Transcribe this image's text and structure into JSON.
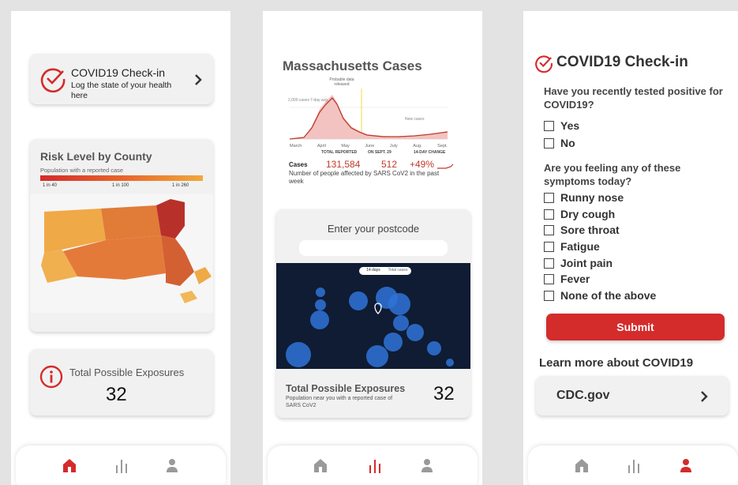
{
  "colors": {
    "accent": "#d42b2b",
    "text": "#222222",
    "grey_icon": "#9a9a9a",
    "map_dark": "#0f1c33",
    "bubble": "#2f73d8"
  },
  "screen1": {
    "checkin": {
      "title": "COVID19 Check-in",
      "subtitle": "Log the state of your health here"
    },
    "risk": {
      "title": "Risk Level by County",
      "legend_caption": "Population with a reported case",
      "legend_ticks": [
        "1 in 40",
        "1 in 100",
        "1 in 260"
      ]
    },
    "exposures": {
      "label": "Total Possible Exposures",
      "value": "32"
    }
  },
  "screen2": {
    "title": "Massachusetts Cases",
    "chart_annotations": {
      "probable": "Probable data released",
      "ytick": "2,000 cases",
      "avg": "7-day avg.",
      "new_cases": "New cases"
    },
    "months": [
      "March",
      "April",
      "May",
      "June",
      "July",
      "Aug.",
      "Sept."
    ],
    "table": {
      "h1": "TOTAL REPORTED",
      "h2": "ON SEPT. 29",
      "h3": "14-DAY CHANGE",
      "row_label": "Cases",
      "total": "131,584",
      "day": "512",
      "change": "+49%"
    },
    "chart_caption": "Number of people affected by SARS CoV2 in the past week",
    "postcode": {
      "label": "Enter your postcode",
      "placeholder": ""
    },
    "map_toggle": [
      "14 days",
      "Total cases"
    ],
    "exposures": {
      "label": "Total Possible Exposures",
      "caption": "Population near you with a reported case of SARS CoV2",
      "value": "32"
    }
  },
  "screen3": {
    "title": "COVID19 Check-in",
    "q1": "Have you recently tested positive for COVID19?",
    "q1_options": [
      "Yes",
      "No"
    ],
    "q2": "Are you feeling any of these symptoms today?",
    "q2_options": [
      "Runny nose",
      "Dry cough",
      "Sore throat",
      "Fatigue",
      "Joint pain",
      "Fever",
      "None of the above"
    ],
    "submit": "Submit",
    "learn_more": "Learn more about COVID19",
    "cdc_link": "CDC.gov"
  }
}
